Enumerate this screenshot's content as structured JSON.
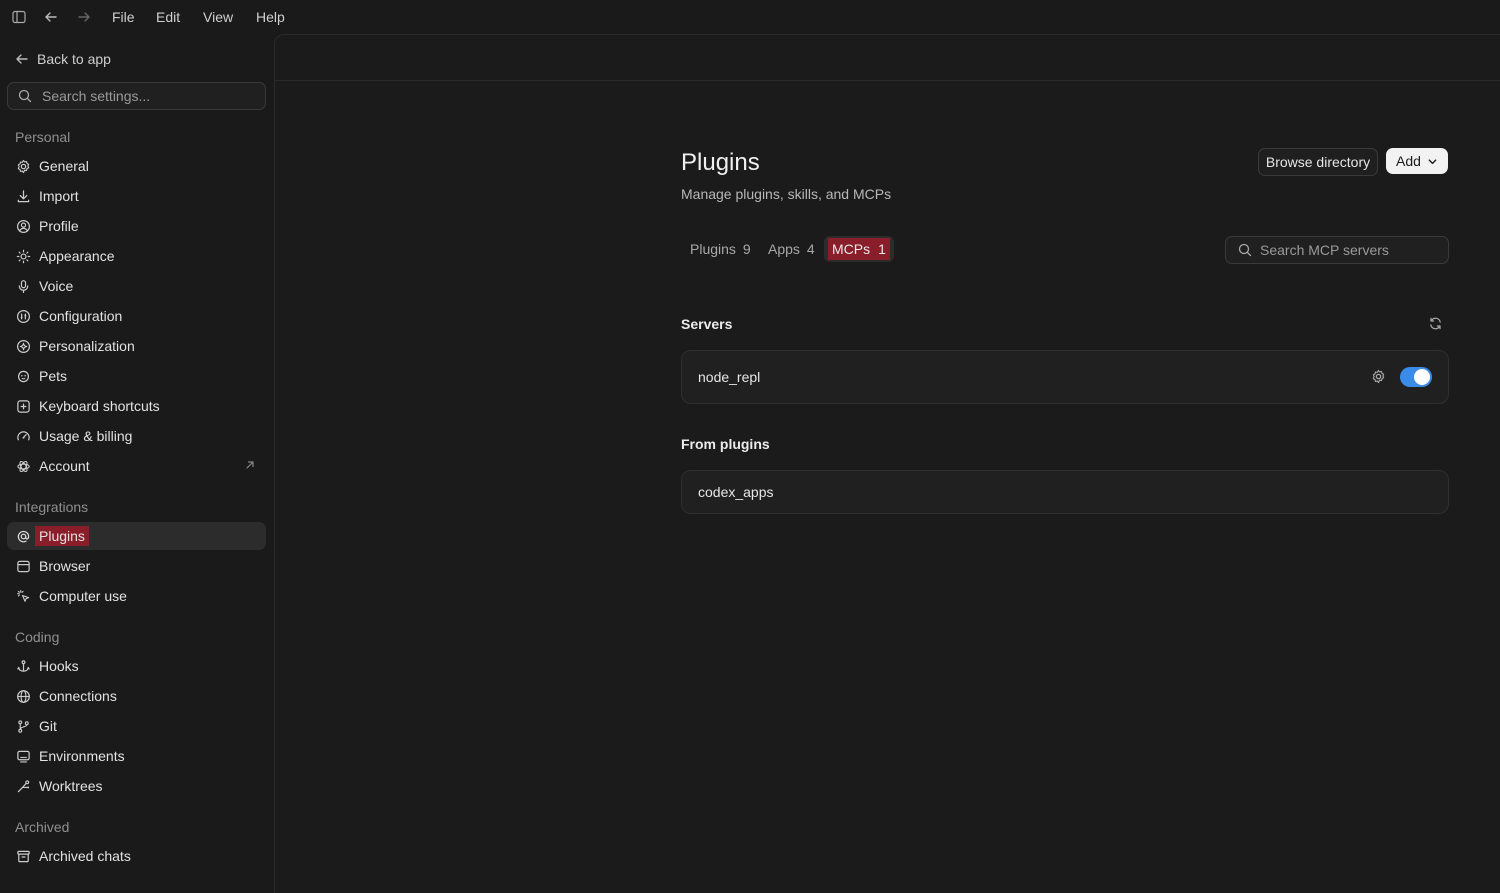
{
  "titlebar": {
    "menu": [
      "File",
      "Edit",
      "View",
      "Help"
    ]
  },
  "sidebar": {
    "back_label": "Back to app",
    "search_placeholder": "Search settings...",
    "sections": [
      {
        "title": "Personal",
        "items": [
          {
            "label": "General",
            "icon": "gear-icon"
          },
          {
            "label": "Import",
            "icon": "download-icon"
          },
          {
            "label": "Profile",
            "icon": "user-circle-icon"
          },
          {
            "label": "Appearance",
            "icon": "sun-icon"
          },
          {
            "label": "Voice",
            "icon": "microphone-icon"
          },
          {
            "label": "Configuration",
            "icon": "sliders-icon"
          },
          {
            "label": "Personalization",
            "icon": "sparkle-circle-icon"
          },
          {
            "label": "Pets",
            "icon": "paw-icon"
          },
          {
            "label": "Keyboard shortcuts",
            "icon": "keyboard-icon"
          },
          {
            "label": "Usage & billing",
            "icon": "gauge-icon"
          },
          {
            "label": "Account",
            "icon": "openai-icon"
          }
        ]
      },
      {
        "title": "Integrations",
        "items": [
          {
            "label": "Plugins",
            "icon": "at-icon"
          },
          {
            "label": "Browser",
            "icon": "browser-window-icon"
          },
          {
            "label": "Computer use",
            "icon": "cursor-click-icon"
          }
        ]
      },
      {
        "title": "Coding",
        "items": [
          {
            "label": "Hooks",
            "icon": "hook-icon"
          },
          {
            "label": "Connections",
            "icon": "globe-icon"
          },
          {
            "label": "Git",
            "icon": "git-branch-icon"
          },
          {
            "label": "Environments",
            "icon": "monitor-icon"
          },
          {
            "label": "Worktrees",
            "icon": "worktree-icon"
          }
        ]
      },
      {
        "title": "Archived",
        "items": [
          {
            "label": "Archived chats",
            "icon": "archive-icon"
          }
        ]
      }
    ]
  },
  "main": {
    "title": "Plugins",
    "subtitle": "Manage plugins, skills, and MCPs",
    "browse_label": "Browse directory",
    "add_label": "Add",
    "tabs": [
      {
        "label": "Plugins",
        "count": "9"
      },
      {
        "label": "Apps",
        "count": "4"
      },
      {
        "label": "MCPs",
        "count": "1"
      }
    ],
    "search_placeholder": "Search MCP servers",
    "servers_heading": "Servers",
    "servers": [
      {
        "name": "node_repl",
        "enabled": true
      }
    ],
    "from_plugins_heading": "From plugins",
    "plugin_servers": [
      {
        "name": "codex_apps"
      }
    ]
  },
  "colors": {
    "accent": "#3b8be8",
    "highlight": "#8a1d2a",
    "background": "#1a1a1a"
  }
}
